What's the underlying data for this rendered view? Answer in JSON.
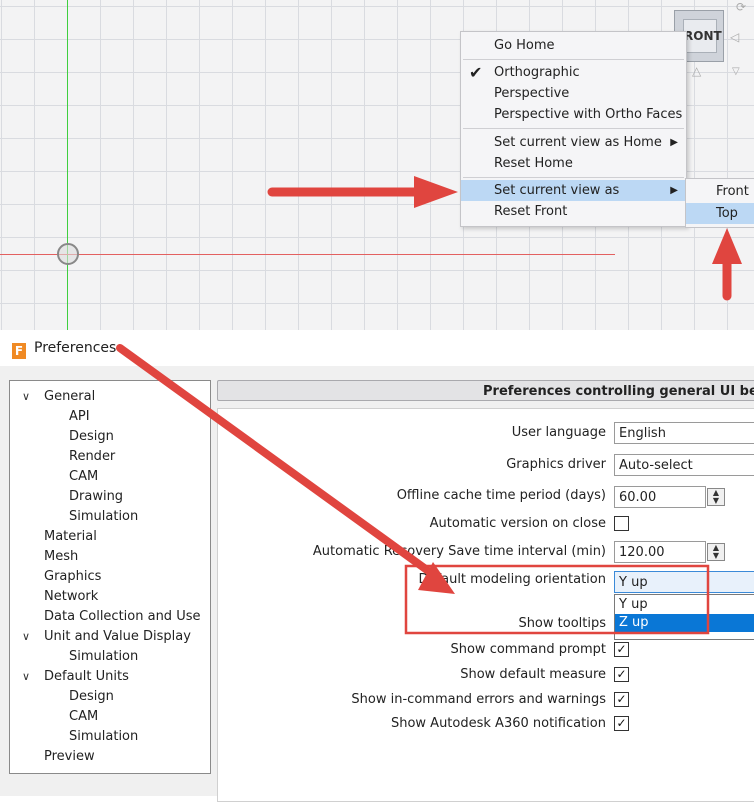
{
  "viewport": {
    "viewcube_label": "RONT"
  },
  "context_menu": {
    "items": [
      {
        "label": "Go Home"
      },
      {
        "label": "Orthographic",
        "checked": true
      },
      {
        "label": "Perspective"
      },
      {
        "label": "Perspective with Ortho Faces"
      },
      {
        "label": "Set current view as Home",
        "submenu": true
      },
      {
        "label": "Reset Home"
      },
      {
        "label": "Set current view as",
        "submenu": true,
        "highlighted": true
      },
      {
        "label": "Reset Front"
      }
    ],
    "check_glyph": "✔",
    "submenu_glyph": "▶"
  },
  "submenu": {
    "items": [
      {
        "label": "Front"
      },
      {
        "label": "Top",
        "highlighted": true
      }
    ]
  },
  "preferences": {
    "title": "Preferences",
    "icon_letter": "F",
    "header": "Preferences controlling general UI behavior",
    "tree": [
      {
        "label": "General",
        "expanded": true,
        "level": 0
      },
      {
        "label": "API",
        "level": 1
      },
      {
        "label": "Design",
        "level": 1
      },
      {
        "label": "Render",
        "level": 1
      },
      {
        "label": "CAM",
        "level": 1
      },
      {
        "label": "Drawing",
        "level": 1
      },
      {
        "label": "Simulation",
        "level": 1
      },
      {
        "label": "Material",
        "level": 0
      },
      {
        "label": "Mesh",
        "level": 0
      },
      {
        "label": "Graphics",
        "level": 0
      },
      {
        "label": "Network",
        "level": 0
      },
      {
        "label": "Data Collection and Use",
        "level": 0
      },
      {
        "label": "Unit and Value Display",
        "expanded": true,
        "level": 0
      },
      {
        "label": "Simulation",
        "level": 1
      },
      {
        "label": "Default Units",
        "expanded": true,
        "level": 0
      },
      {
        "label": "Design",
        "level": 1
      },
      {
        "label": "CAM",
        "level": 1
      },
      {
        "label": "Simulation",
        "level": 1
      },
      {
        "label": "Preview",
        "level": 0
      }
    ],
    "settings": {
      "user_language": {
        "label": "User language",
        "value": "English"
      },
      "graphics_driver": {
        "label": "Graphics driver",
        "value": "Auto-select"
      },
      "offline_cache": {
        "label": "Offline cache time period (days)",
        "value": "60.00"
      },
      "auto_version": {
        "label": "Automatic version on close",
        "checked": false
      },
      "auto_recovery": {
        "label": "Automatic Recovery Save time interval (min)",
        "value": "120.00"
      },
      "modeling_orientation": {
        "label": "Default modeling orientation",
        "value": "Y up",
        "options": [
          "Y up",
          "Z up"
        ],
        "selected_option": "Z up"
      },
      "show_tooltips": {
        "label": "Show tooltips"
      },
      "show_command_prompt": {
        "label": "Show command prompt",
        "checked": true
      },
      "show_default_measure": {
        "label": "Show default measure",
        "checked": true
      },
      "show_errors": {
        "label": "Show in-command errors and warnings",
        "checked": true
      },
      "show_a360": {
        "label": "Show Autodesk A360 notification",
        "checked": true
      }
    },
    "check_glyph": "✓",
    "expand_glyph": "∨"
  },
  "colors": {
    "annotation_red": "#e0453f",
    "menu_highlight": "#bcd8f4",
    "dropdown_selected": "#0a77d6",
    "x_axis": "#e36060",
    "y_axis": "#3fcf3f"
  }
}
